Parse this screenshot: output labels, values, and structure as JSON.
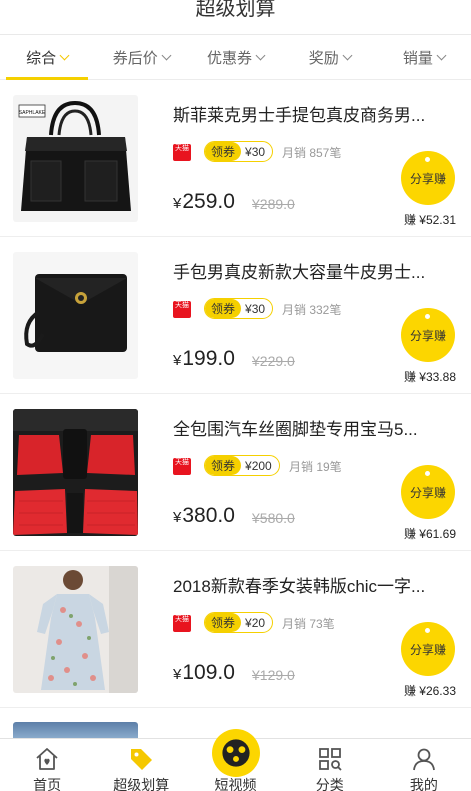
{
  "header": {
    "title": "超级划算"
  },
  "filters": [
    {
      "label": "综合",
      "active": true
    },
    {
      "label": "券后价",
      "active": false
    },
    {
      "label": "优惠券",
      "active": false
    },
    {
      "label": "奖励",
      "active": false
    },
    {
      "label": "销量",
      "active": false
    }
  ],
  "items": [
    {
      "name": "斯菲莱克男士手提包真皮商务男...",
      "badge": "天猫",
      "coupon_label": "领券",
      "coupon_value": "¥30",
      "sales": "月销 857笔",
      "currency": "¥",
      "price": "259.0",
      "orig": "¥289.0",
      "share": "分享赚",
      "earn": "赚 ¥52.31",
      "image": "black-leather-handbag",
      "thumb_text": "SAPHLAKE"
    },
    {
      "name": "手包男真皮新款大容量牛皮男士...",
      "badge": "天猫",
      "coupon_label": "领券",
      "coupon_value": "¥30",
      "sales": "月销 332笔",
      "currency": "¥",
      "price": "199.0",
      "orig": "¥229.0",
      "share": "分享赚",
      "earn": "赚 ¥33.88",
      "image": "black-leather-clutch"
    },
    {
      "name": "全包围汽车丝圈脚垫专用宝马5...",
      "badge": "天猫",
      "coupon_label": "领券",
      "coupon_value": "¥200",
      "sales": "月销 19笔",
      "currency": "¥",
      "price": "380.0",
      "orig": "¥580.0",
      "share": "分享赚",
      "earn": "赚 ¥61.69",
      "image": "red-car-floor-mats"
    },
    {
      "name": "2018新款春季女装韩版chic一字...",
      "badge": "天猫",
      "coupon_label": "领券",
      "coupon_value": "¥20",
      "sales": "月销 73笔",
      "currency": "¥",
      "price": "109.0",
      "orig": "¥129.0",
      "share": "分享赚",
      "earn": "赚 ¥26.33",
      "image": "floral-dress"
    }
  ],
  "tabbar": [
    {
      "label": "首页",
      "icon": "home-icon"
    },
    {
      "label": "超级划算",
      "icon": "tag-icon"
    },
    {
      "label": "短视频",
      "icon": "video-face-icon"
    },
    {
      "label": "分类",
      "icon": "category-icon"
    },
    {
      "label": "我的",
      "icon": "user-icon"
    }
  ],
  "colors": {
    "accent": "#fcd600",
    "tmall": "#e8141f"
  }
}
